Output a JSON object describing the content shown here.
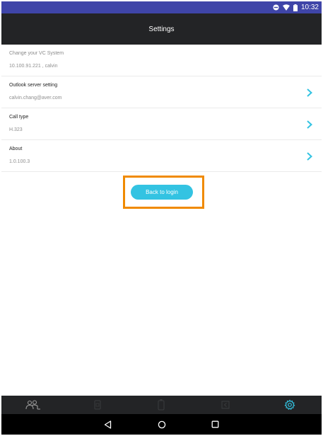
{
  "status_bar": {
    "time": "10:32"
  },
  "app_bar": {
    "title": "Settings"
  },
  "settings": [
    {
      "label": "Change your VC System",
      "value": "10.100.91.221 , calvin",
      "has_chevron": false
    },
    {
      "label": "Outlook server setting",
      "value": "calvin.chang@aver.com",
      "has_chevron": true
    },
    {
      "label": "Call type",
      "value": "H.323",
      "has_chevron": true
    },
    {
      "label": "About",
      "value": "1.0.100.3",
      "has_chevron": true
    }
  ],
  "back_button": {
    "label": "Back to login"
  },
  "tabs": [
    {
      "name": "contacts-icon",
      "active": false
    },
    {
      "name": "phone-icon",
      "active": false
    },
    {
      "name": "remote-icon",
      "active": false
    },
    {
      "name": "layout-icon",
      "active": false
    },
    {
      "name": "settings-gear-icon",
      "active": true
    }
  ],
  "nav": [
    "back-icon",
    "home-icon",
    "recents-icon"
  ],
  "colors": {
    "status_bar": "#3f45a8",
    "app_bar": "#232426",
    "accent": "#33c3e2",
    "highlight": "#f08a00",
    "tab_inactive": "#3a3b3d"
  }
}
